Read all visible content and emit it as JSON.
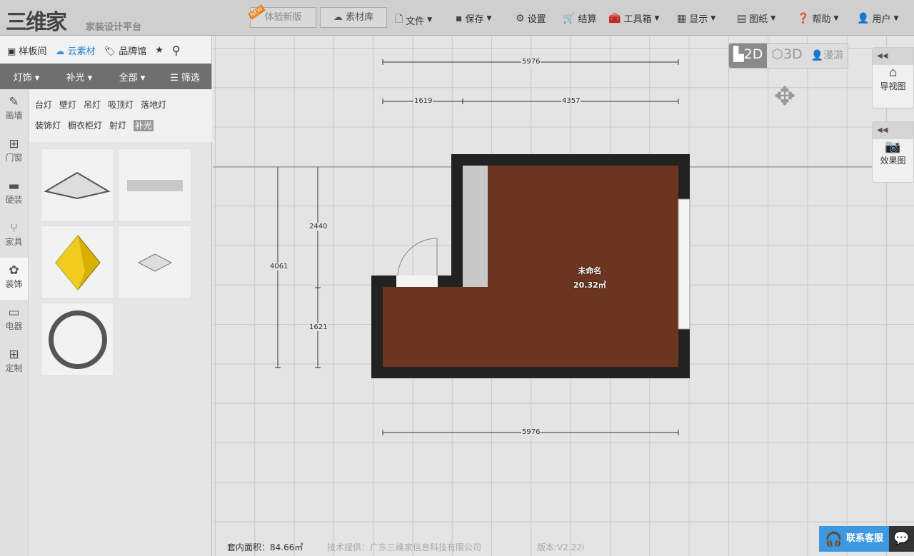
{
  "header": {
    "logo": "三维家",
    "slogan": "家装设计平台",
    "new_badge": "NEW",
    "try_new": "体验新版",
    "library": "素材库",
    "menus": [
      {
        "icon": "file-icon",
        "label": "文件",
        "dd": true
      },
      {
        "icon": "save-icon",
        "label": "保存",
        "dd": true
      },
      {
        "icon": "gear-icon",
        "label": "设置",
        "dd": false
      },
      {
        "icon": "cart-icon",
        "label": "结算",
        "dd": false
      },
      {
        "icon": "toolbox-icon",
        "label": "工具箱",
        "dd": true
      },
      {
        "icon": "grid-icon",
        "label": "显示",
        "dd": true
      },
      {
        "icon": "drawing-icon",
        "label": "图纸",
        "dd": true
      },
      {
        "icon": "help-icon",
        "label": "帮助",
        "dd": true
      },
      {
        "icon": "user-icon",
        "label": "用户",
        "dd": true
      }
    ]
  },
  "sidebar": {
    "tabs": [
      "样板间",
      "云素材",
      "品牌馆"
    ],
    "active_tab": "云素材",
    "filters": [
      "灯饰",
      "补光",
      "全部"
    ],
    "filter_button": "筛选",
    "vnav": [
      {
        "icon": "pencil-icon",
        "label": "画墙"
      },
      {
        "icon": "window-icon",
        "label": "门窗"
      },
      {
        "icon": "roller-icon",
        "label": "硬装"
      },
      {
        "icon": "chair-icon",
        "label": "家具"
      },
      {
        "icon": "plant-icon",
        "label": "装饰"
      },
      {
        "icon": "monitor-icon",
        "label": "电器"
      },
      {
        "icon": "apps-icon",
        "label": "定制"
      }
    ],
    "active_vnav": "装饰",
    "categories": [
      "台灯",
      "壁灯",
      "吊灯",
      "吸顶灯",
      "落地灯",
      "装饰灯",
      "橱衣柜灯",
      "射灯",
      "补光"
    ],
    "selected_category": "补光"
  },
  "canvas": {
    "dims": {
      "top_total": "5976",
      "top_left": "1619",
      "top_right": "4357",
      "bottom_total": "5976",
      "left_total": "4061",
      "left_upper": "2440",
      "left_lower": "1621"
    },
    "room": {
      "name": "未命名",
      "area": "20.32㎡"
    },
    "floor_color": "#6b3520"
  },
  "view": {
    "modes": [
      "2D",
      "3D",
      "漫游"
    ],
    "active": "2D"
  },
  "right_panels": [
    {
      "label": "导视图"
    },
    {
      "label": "效果图"
    }
  ],
  "footer": {
    "area": "套内面积：84.66㎡",
    "provider": "技术提供：广东三维家信息科技有限公司",
    "version": "版本:V2.22i",
    "service": "联系客服"
  }
}
